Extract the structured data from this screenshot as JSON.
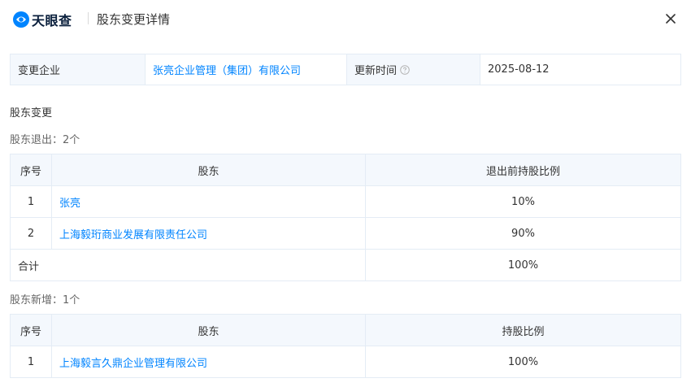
{
  "header": {
    "logo_text": "天眼查",
    "title": "股东变更详情",
    "close_symbol": "×"
  },
  "info": {
    "company_label": "变更企业",
    "company_name": "张亮企业管理（集团）有限公司",
    "update_label": "更新时间",
    "update_date": "2025-08-12"
  },
  "section_title": "股东变更",
  "exit": {
    "title": "股东退出：2个",
    "headers": [
      "序号",
      "股东",
      "退出前持股比例"
    ],
    "rows": [
      {
        "index": "1",
        "name": "张亮",
        "ratio": "10%"
      },
      {
        "index": "2",
        "name": "上海毅珩商业发展有限责任公司",
        "ratio": "90%"
      }
    ],
    "total_label": "合计",
    "total_ratio": "100%"
  },
  "add": {
    "title": "股东新增：1个",
    "headers": [
      "序号",
      "股东",
      "持股比例"
    ],
    "rows": [
      {
        "index": "1",
        "name": "上海毅言久鼎企业管理有限公司",
        "ratio": "100%"
      }
    ]
  },
  "colors": {
    "link": "#0084ff",
    "header_bg": "#f4f8fd",
    "border": "#e4ecf5"
  }
}
